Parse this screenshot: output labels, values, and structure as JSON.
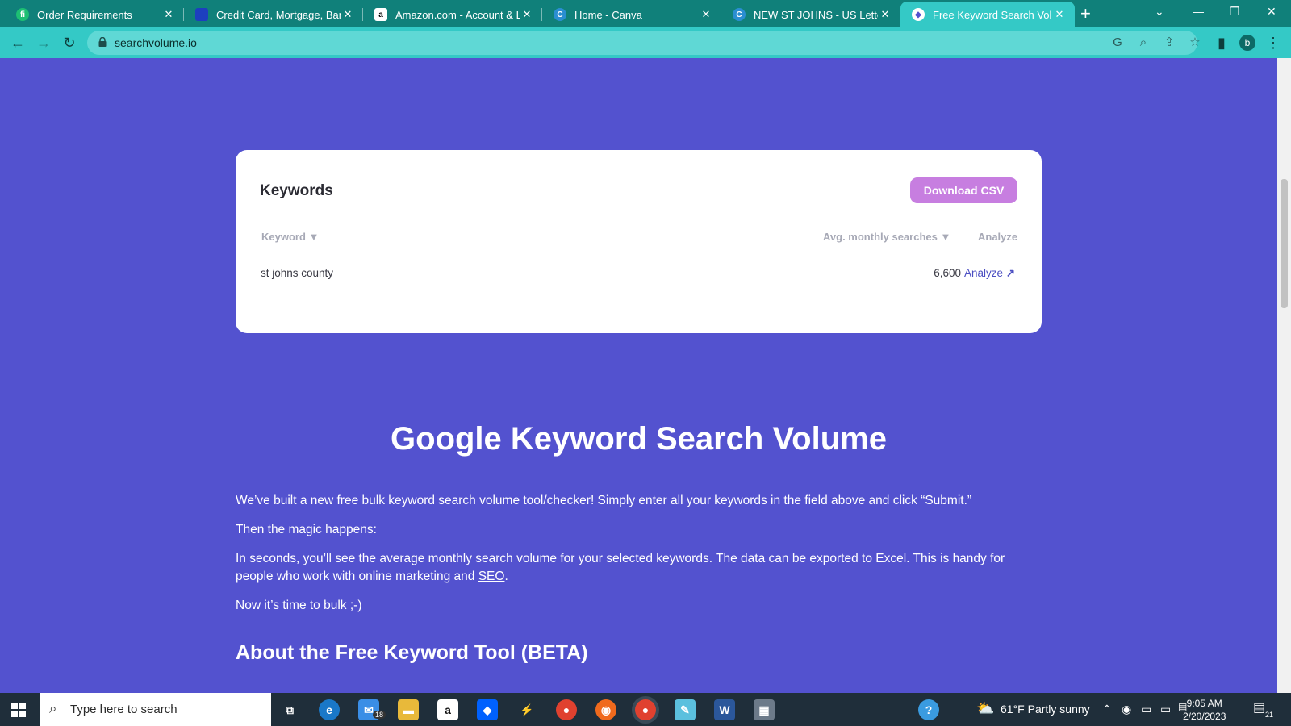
{
  "browser": {
    "tabs": [
      {
        "title": "Order Requirements",
        "favicon": "fiverr-icon",
        "active": false
      },
      {
        "title": "Credit Card, Mortgage, Bankin",
        "favicon": "bank-icon",
        "active": false
      },
      {
        "title": "Amazon.com - Account & Lo",
        "favicon": "amazon-icon",
        "active": false
      },
      {
        "title": "Home - Canva",
        "favicon": "canva-icon",
        "active": false
      },
      {
        "title": "NEW ST JOHNS - US Letter",
        "favicon": "canva-icon",
        "active": false
      },
      {
        "title": "Free Keyword Search Volume",
        "favicon": "searchvolume-icon",
        "active": true
      }
    ],
    "url": "searchvolume.io",
    "profile_initial": "b"
  },
  "card": {
    "title": "Keywords",
    "download_label": "Download CSV",
    "columns": {
      "keyword": "Keyword",
      "volume": "Avg. monthly searches",
      "analyze": "Analyze"
    },
    "rows": [
      {
        "keyword": "st johns county",
        "volume": "6,600",
        "analyze": "Analyze"
      }
    ]
  },
  "content": {
    "heading": "Google Keyword Search Volume",
    "p1": "We’ve built a new free bulk keyword search volume tool/checker! Simply enter all your keywords in the field above and click “Submit.”",
    "p2": "Then the magic happens:",
    "p3_before": "In seconds, you’ll see the average monthly search volume for your selected keywords. The data can be exported to Excel. This is handy for people who work with online marketing and ",
    "p3_link": "SEO",
    "p3_after": ".",
    "p4": "Now it’s time to bulk ;-)",
    "subheading": "About the Free Keyword Tool (BETA)"
  },
  "taskbar": {
    "search_placeholder": "Type here to search",
    "mail_badge": "18",
    "weather": "61°F  Partly sunny",
    "time": "9:05 AM",
    "date": "2/20/2023",
    "notifications": "21"
  }
}
